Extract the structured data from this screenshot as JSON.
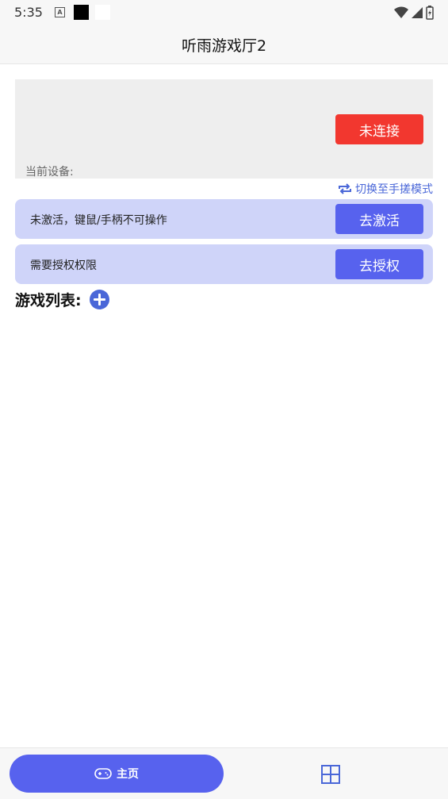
{
  "status_bar": {
    "time": "5:35",
    "notif_letter": "A"
  },
  "app": {
    "title": "听雨游戏厅2"
  },
  "device": {
    "connect_label": "未连接",
    "current_device_label": "当前设备:",
    "connect_color": "#f2372f"
  },
  "switch_mode": {
    "label": "切换至手搓模式",
    "icon": "repeat-icon"
  },
  "banners": [
    {
      "text": "未激活，键鼠/手柄不可操作",
      "button": "去激活"
    },
    {
      "text": "需要授权权限",
      "button": "去授权"
    }
  ],
  "game_list": {
    "title": "游戏列表:",
    "add_icon": "plus-circle-icon"
  },
  "bottom_nav": {
    "home_label": "主页",
    "home_icon": "gamepad-icon",
    "second_icon": "grid-icon"
  },
  "colors": {
    "accent": "#5762ee",
    "banner_bg": "#cfd4f9",
    "link": "#4a67d8"
  }
}
